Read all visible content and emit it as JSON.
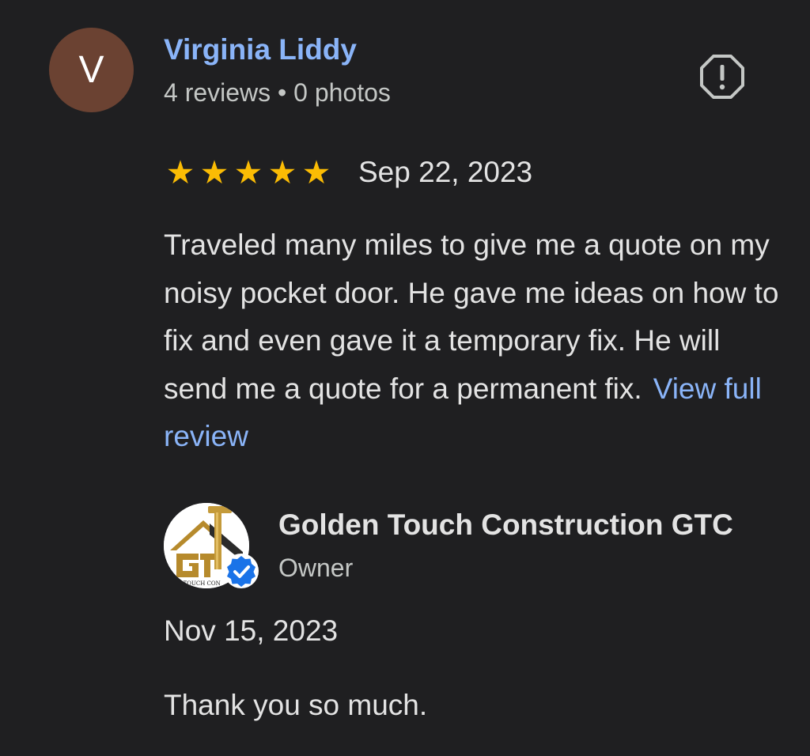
{
  "review": {
    "avatar_initial": "V",
    "avatar_color": "#6b4232",
    "reviewer_name": "Virginia Liddy",
    "reviewer_meta": "4 reviews • 0 photos",
    "report_icon": "report-flag-icon",
    "rating": 5,
    "rating_max": 5,
    "star_color": "#fbbc04",
    "date": "Sep 22, 2023",
    "text": "Traveled many miles to give me a quote on my noisy pocket door. He gave me ideas on how to fix and even gave it a temporary fix. He will send me a quote for a permanent fix.",
    "view_full_label": "View full review",
    "link_color": "#8ab4f8"
  },
  "owner_reply": {
    "logo_icon": "golden-touch-logo",
    "logo_text": "N TOUCH CON",
    "verified_icon": "verified-badge-icon",
    "name": "Golden Touch Construction GTC",
    "role": "Owner",
    "date": "Nov 15, 2023",
    "text": "Thank you so much."
  }
}
